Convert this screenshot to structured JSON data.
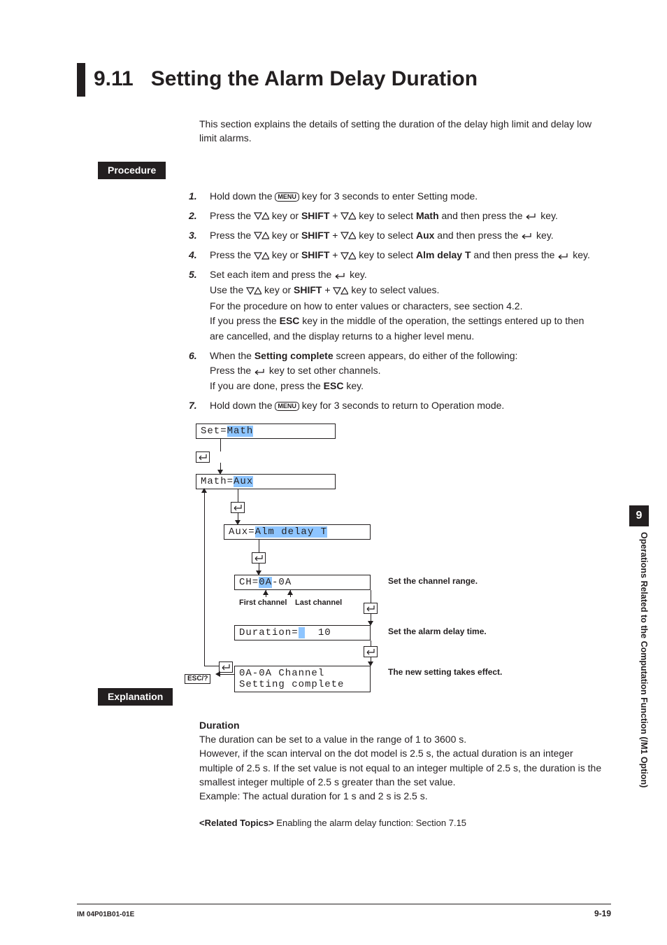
{
  "heading": {
    "number": "9.11",
    "title": "Setting the Alarm Delay Duration"
  },
  "intro": "This section explains the details of setting the duration of the delay high limit and delay low limit alarms.",
  "labels": {
    "procedure": "Procedure",
    "explanation": "Explanation",
    "menu": "MENU",
    "esc": "ESC/?",
    "shift": "SHIFT",
    "escPlain": "ESC"
  },
  "steps": {
    "s1a": "Hold down the ",
    "s1b": " key for 3 seconds to enter Setting mode.",
    "s2a": "Press the ",
    "s2b": " key or ",
    "s2c": " + ",
    "s2d": " key to select ",
    "s2e": "Math",
    "s2f": " and then press the ",
    "s2g": " key.",
    "s3e": "Aux",
    "s4e": "Alm delay T",
    "s4f": " and then press the ",
    "s5a": "Set each item and press the ",
    "s5b": " key.",
    "s5c": "Use the ",
    "s5d": " key to select values.",
    "s5e": "For the procedure on how to enter values or characters, see section 4.2.",
    "s5f": "If you press the ",
    "s5g": " key in the middle of the operation, the settings entered up to then are cancelled, and the display returns to a higher level menu.",
    "s6a": "When the ",
    "s6b": "Setting complete",
    "s6c": " screen appears, do either of the following:",
    "s6d": "Press the ",
    "s6e": " key to set other channels.",
    "s6f": "If you are done, press the ",
    "s7b": " key for 3 seconds to return to Operation mode."
  },
  "diagram": {
    "r1a": "Set=",
    "r1b": "Math",
    "r2a": "Math=",
    "r2b": "Aux",
    "r3a": "Aux=",
    "r3b": "Alm delay T",
    "r4a": "CH=",
    "r4b": "0A",
    "r4c": "-0A",
    "r5a": "Duration=",
    "r5b": " ",
    "r5c": "  10",
    "r6a": "0A-0A Channel",
    "r6b": "Setting complete",
    "firstCh": "First channel",
    "lastCh": "Last channel",
    "cap1": "Set the channel range.",
    "cap2": "Set the alarm delay time.",
    "cap3": "The new setting takes effect."
  },
  "explanation": {
    "h1": "Duration",
    "p1": "The duration can be set to a value in the range of 1 to 3600 s.",
    "p2": "However, if the scan interval on the dot model is 2.5 s, the actual duration is an integer multiple of 2.5 s. If the set value is not equal to an integer multiple of 2.5 s, the duration is the smallest integer multiple of 2.5 s greater than the set value.",
    "p3": "Example: The actual duration for 1 s and 2 s is 2.5 s."
  },
  "related": {
    "label": "<Related Topics>",
    "text": "  Enabling the alarm delay function: Section 7.15"
  },
  "footer": {
    "left": "IM 04P01B01-01E",
    "right": "9-19"
  },
  "side": {
    "chapter": "9",
    "title": "Operations Related to the Computation Function (/M1 Option)"
  }
}
